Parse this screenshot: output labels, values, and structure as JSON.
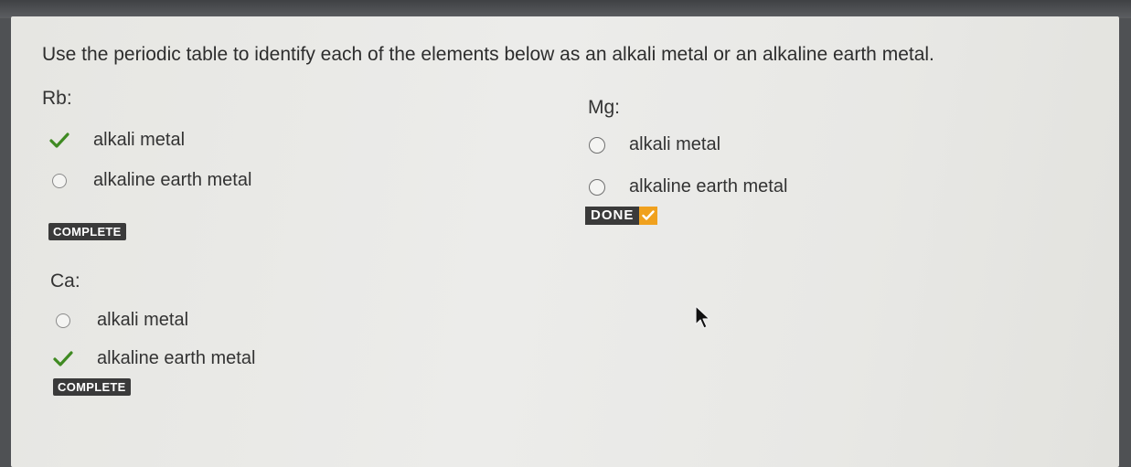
{
  "prompt": "Use the periodic table to identify each of the elements below as an alkali metal or an alkaline earth metal.",
  "questions": [
    {
      "label": "Rb:",
      "options": [
        {
          "label": "alkali metal",
          "state": "checked"
        },
        {
          "label": "alkaline earth metal",
          "state": "unselected"
        }
      ],
      "badge": "COMPLETE"
    },
    {
      "label": "Mg:",
      "options": [
        {
          "label": "alkali metal",
          "state": "unselected"
        },
        {
          "label": "alkaline earth metal",
          "state": "unselected"
        }
      ],
      "badge": "DONE"
    },
    {
      "label": "Ca:",
      "options": [
        {
          "label": "alkali metal",
          "state": "unselected"
        },
        {
          "label": "alkaline earth metal",
          "state": "checked"
        }
      ],
      "badge": "COMPLETE"
    }
  ],
  "colors": {
    "check": "#3f8a22",
    "done_accent": "#f0a11e",
    "badge_bg": "#3a3a3a"
  },
  "icons": {
    "check": "checkmark-icon",
    "radio": "radio-empty-icon",
    "cursor": "mouse-pointer-icon"
  }
}
